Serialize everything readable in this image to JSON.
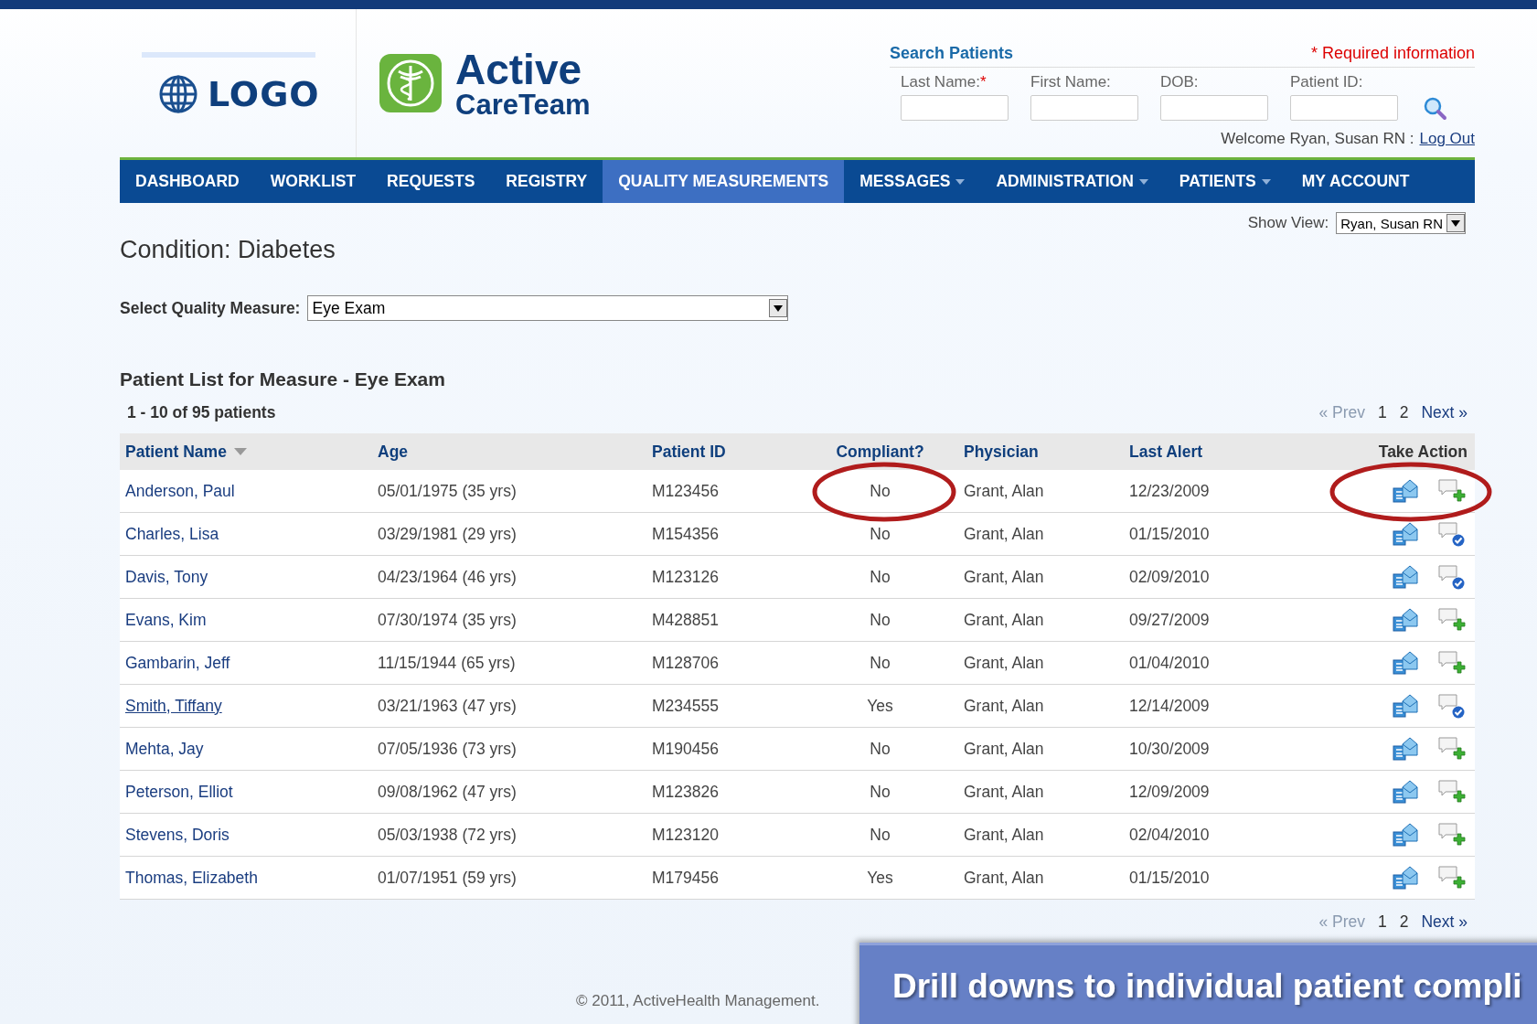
{
  "header": {
    "logo_placeholder": "LOGO",
    "brand": {
      "line1": "Active",
      "line2": "CareTeam"
    },
    "search": {
      "title": "Search Patients",
      "required_note": "* Required information",
      "fields": [
        {
          "label": "Last Name:",
          "required_mark": "*"
        },
        {
          "label": "First Name:"
        },
        {
          "label": "DOB:"
        },
        {
          "label": "Patient ID:"
        }
      ]
    },
    "welcome": "Welcome Ryan, Susan RN :",
    "logout": "Log Out"
  },
  "nav": [
    {
      "label": "DASHBOARD",
      "selected": false,
      "dropdown": false
    },
    {
      "label": "WORKLIST",
      "selected": false,
      "dropdown": false
    },
    {
      "label": "REQUESTS",
      "selected": false,
      "dropdown": false
    },
    {
      "label": "REGISTRY",
      "selected": false,
      "dropdown": false
    },
    {
      "label": "QUALITY MEASUREMENTS",
      "selected": true,
      "dropdown": false
    },
    {
      "label": "MESSAGES",
      "selected": false,
      "dropdown": true
    },
    {
      "label": "ADMINISTRATION",
      "selected": false,
      "dropdown": true
    },
    {
      "label": "PATIENTS",
      "selected": false,
      "dropdown": true
    },
    {
      "label": "MY ACCOUNT",
      "selected": false,
      "dropdown": false
    }
  ],
  "show_view": {
    "label": "Show View:",
    "value": "Ryan, Susan RN"
  },
  "condition": "Condition: Diabetes",
  "measure": {
    "label": "Select Quality Measure:",
    "value": "Eye Exam"
  },
  "list_title": "Patient List for Measure - Eye Exam",
  "count": "1 - 10 of 95 patients",
  "pagination": {
    "prev": "« Prev",
    "pages": [
      "1",
      "2"
    ],
    "next": "Next »"
  },
  "table": {
    "columns": [
      "Patient Name",
      "Age",
      "Patient ID",
      "Compliant?",
      "Physician",
      "Last Alert",
      "Take Action"
    ],
    "rows": [
      {
        "name": "Anderson, Paul",
        "age": "05/01/1975 (35 yrs)",
        "id": "M123456",
        "compliant": "No",
        "physician": "Grant, Alan",
        "last_alert": "12/23/2009",
        "kind": "add",
        "hovered": false
      },
      {
        "name": "Charles, Lisa",
        "age": "03/29/1981 (29 yrs)",
        "id": "M154356",
        "compliant": "No",
        "physician": "Grant, Alan",
        "last_alert": "01/15/2010",
        "kind": "done",
        "hovered": false
      },
      {
        "name": "Davis, Tony",
        "age": "04/23/1964 (46 yrs)",
        "id": "M123126",
        "compliant": "No",
        "physician": "Grant, Alan",
        "last_alert": "02/09/2010",
        "kind": "done",
        "hovered": false
      },
      {
        "name": "Evans, Kim",
        "age": "07/30/1974 (35 yrs)",
        "id": "M428851",
        "compliant": "No",
        "physician": "Grant, Alan",
        "last_alert": "09/27/2009",
        "kind": "add",
        "hovered": false
      },
      {
        "name": "Gambarin, Jeff",
        "age": "11/15/1944 (65 yrs)",
        "id": "M128706",
        "compliant": "No",
        "physician": "Grant, Alan",
        "last_alert": "01/04/2010",
        "kind": "add",
        "hovered": false
      },
      {
        "name": "Smith, Tiffany",
        "age": "03/21/1963 (47 yrs)",
        "id": "M234555",
        "compliant": "Yes",
        "physician": "Grant, Alan",
        "last_alert": "12/14/2009",
        "kind": "done",
        "hovered": true
      },
      {
        "name": "Mehta, Jay",
        "age": "07/05/1936 (73 yrs)",
        "id": "M190456",
        "compliant": "No",
        "physician": "Grant, Alan",
        "last_alert": "10/30/2009",
        "kind": "add",
        "hovered": false
      },
      {
        "name": "Peterson, Elliot",
        "age": "09/08/1962 (47 yrs)",
        "id": "M123826",
        "compliant": "No",
        "physician": "Grant, Alan",
        "last_alert": "12/09/2009",
        "kind": "add",
        "hovered": false
      },
      {
        "name": "Stevens, Doris",
        "age": "05/03/1938 (72 yrs)",
        "id": "M123120",
        "compliant": "No",
        "physician": "Grant, Alan",
        "last_alert": "02/04/2010",
        "kind": "add",
        "hovered": false
      },
      {
        "name": "Thomas, Elizabeth",
        "age": "01/07/1951 (59 yrs)",
        "id": "M179456",
        "compliant": "Yes",
        "physician": "Grant, Alan",
        "last_alert": "01/15/2010",
        "kind": "add",
        "hovered": false
      }
    ]
  },
  "bottom_pagination": {
    "prev": "« Prev",
    "pages": [
      "1",
      "2"
    ],
    "next": "Next »"
  },
  "footer": "© 2011, ActiveHealth Management.",
  "callout": "Drill downs to individual patient compli"
}
